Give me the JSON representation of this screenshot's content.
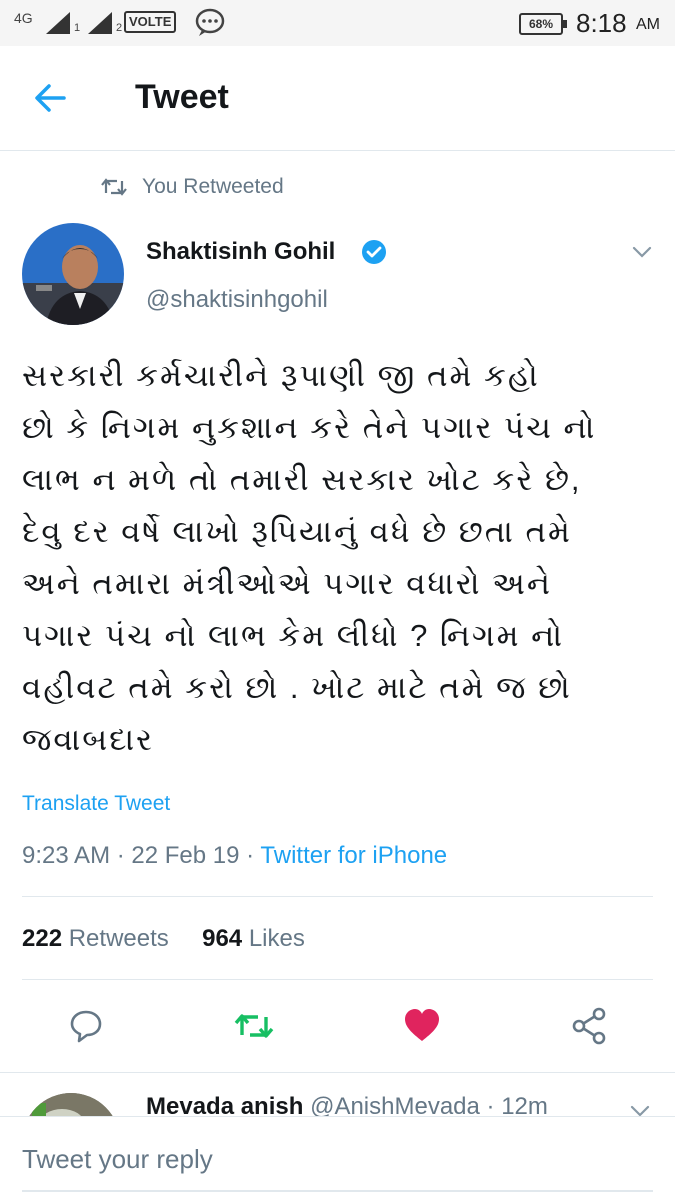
{
  "status_bar": {
    "network": "4G",
    "sim1": "1",
    "sim2": "2",
    "volte": "VOLTE",
    "battery": "68%",
    "time": "8:18",
    "ampm": "AM"
  },
  "header": {
    "title": "Tweet",
    "back_icon": "back-arrow-icon"
  },
  "context": {
    "retweet_label": "You Retweeted"
  },
  "tweet": {
    "author_name": "Shaktisinh Gohil",
    "verified": true,
    "handle": "@shaktisinhgohil",
    "text_lines": [
      "સરકારી કર્મચારીને રૂપાણી જી તમે  કહો",
      "છો કે નિગમ નુકશાન કરે તેને પગાર પંચ નો",
      "લાભ ન મળે તો તમારી સરકાર ખોટ કરે છે,",
      "દેવુ  દર વર્ષે  લાખો રૂપિયાનું વધે છે છતા તમે",
      "અને તમારા મંત્રીઓએ પગાર વધારો અને",
      "પગાર પંચ નો લાભ કેમ લીધો ? નિગમ નો",
      "વહીવટ તમે કરો છો . ખોટ માટે તમે જ છો",
      "જવાબદાર"
    ],
    "translate_label": "Translate Tweet",
    "time": "9:23 AM",
    "date": "22 Feb 19",
    "source": "Twitter for iPhone",
    "retweet_count": "222",
    "retweets_label": "Retweets",
    "like_count": "964",
    "likes_label": "Likes",
    "liked": true
  },
  "actions": {
    "reply_icon": "reply-icon",
    "retweet_icon": "retweet-icon",
    "like_icon": "heart-icon",
    "share_icon": "share-icon"
  },
  "reply_preview": {
    "name": "Mevada anish",
    "handle": "@AnishMevada",
    "time": "12m"
  },
  "reply_bar": {
    "placeholder": "Tweet your reply"
  },
  "colors": {
    "accent": "#1da1f2",
    "retweet": "#17bf63",
    "like": "#e0245e",
    "secondary_text": "#657786",
    "divider": "#e1e8ed"
  }
}
